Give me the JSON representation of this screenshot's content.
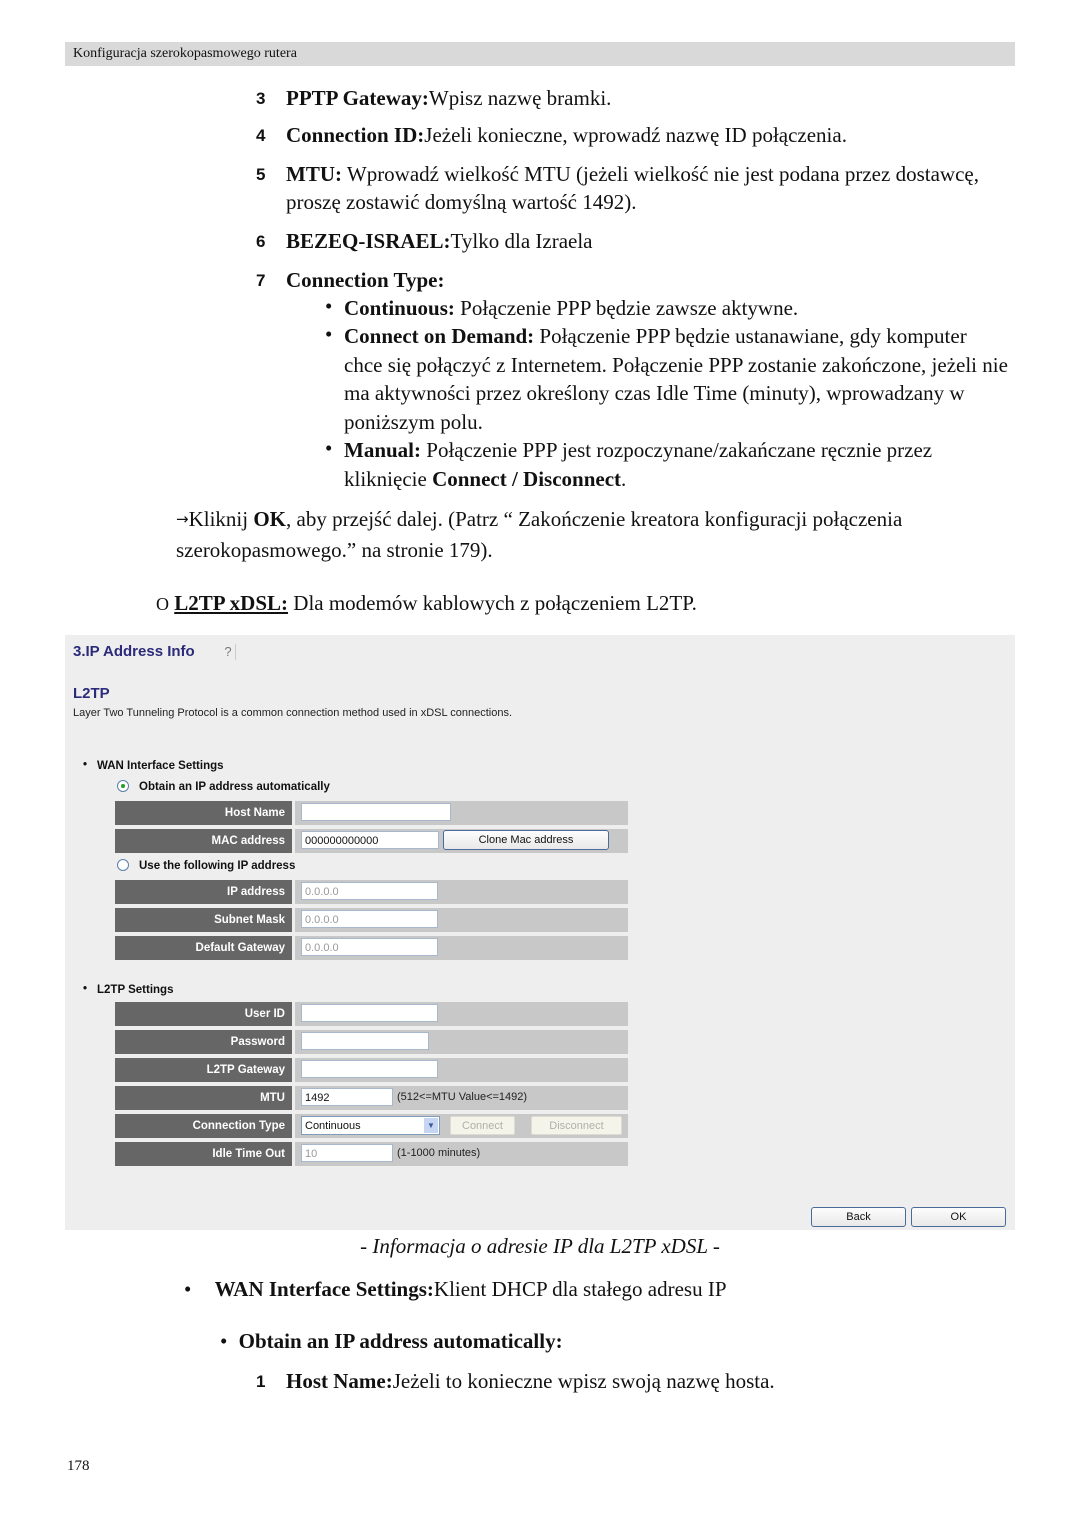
{
  "header": {
    "title": "Konfiguracja szerokopasmowego rutera"
  },
  "steps_top": [
    {
      "num": "3",
      "bold": "PPTP Gateway:",
      "text": "Wpisz nazwę bramki."
    },
    {
      "num": "4",
      "bold": "Connection ID:",
      "text": "Jeżeli konieczne, wprowadź nazwę ID połączenia."
    },
    {
      "num": "5",
      "bold": "MTU:",
      "text": " Wprowadź wielkość MTU (jeżeli wielkość nie jest podana przez dostawcę, proszę zostawić domyślną wartość 1492)."
    },
    {
      "num": "6",
      "bold": "BEZEQ-ISRAEL:",
      "text": "Tylko dla Izraela"
    },
    {
      "num": "7",
      "bold": "Connection Type:",
      "text": ""
    }
  ],
  "connection_types": [
    {
      "bold": "Continuous:",
      "text": " Połączenie PPP będzie zawsze aktywne."
    },
    {
      "bold": "Connect on Demand:",
      "text": " Połączenie PPP będzie ustanawiane, gdy komputer chce się połączyć z Internetem. Połączenie PPP zostanie zakończone, jeżeli nie ma aktywności przez określony czas Idle Time (minuty), wprowadzany w poniższym polu."
    },
    {
      "bold": "Manual:",
      "text": " Połączenie PPP jest rozpoczynane/zakańczane ręcznie przez kliknięcie ",
      "bold2": "Connect / Disconnect",
      "tail": "."
    }
  ],
  "click_ok": {
    "arrow": "→",
    "pre": "Kliknij ",
    "bold": "OK",
    "post": ", aby przejść dalej. (Patrz “ Zakończenie kreatora konfiguracji połączenia szerokopasmowego.” na stronie 179)."
  },
  "l2tp_option": {
    "marker": "O",
    "label": "L2TP xDSL:",
    "text": " Dla modemów kablowych z połączeniem L2TP."
  },
  "screenshot": {
    "title": "3.IP Address Info",
    "help_icon": "help-icon",
    "heading": "L2TP",
    "description": "Layer Two Tunneling Protocol is a common connection method used in xDSL connections.",
    "wan_section": "WAN Interface Settings",
    "radio_auto": {
      "label": "Obtain an IP address automatically",
      "selected": true
    },
    "host_name": {
      "label": "Host Name",
      "value": ""
    },
    "mac_address": {
      "label": "MAC address",
      "value": "000000000000",
      "button": "Clone Mac address"
    },
    "radio_manual": {
      "label": "Use the following IP address",
      "selected": false
    },
    "ip_address": {
      "label": "IP address",
      "value": "0.0.0.0"
    },
    "subnet_mask": {
      "label": "Subnet Mask",
      "value": "0.0.0.0"
    },
    "default_gateway": {
      "label": "Default Gateway",
      "value": "0.0.0.0"
    },
    "l2tp_section": "L2TP Settings",
    "user_id": {
      "label": "User ID",
      "value": ""
    },
    "password": {
      "label": "Password",
      "value": ""
    },
    "l2tp_gateway": {
      "label": "L2TP Gateway",
      "value": ""
    },
    "mtu": {
      "label": "MTU",
      "value": "1492",
      "hint": "(512<=MTU Value<=1492)"
    },
    "connection_type": {
      "label": "Connection Type",
      "value": "Continuous",
      "connect": "Connect",
      "disconnect": "Disconnect"
    },
    "idle_time": {
      "label": "Idle Time Out",
      "value": "10",
      "hint": "(1-1000 minutes)"
    },
    "back": "Back",
    "ok": "OK"
  },
  "caption": "- Informacja o adresie IP dla L2TP xDSL -",
  "wan_note": {
    "bullet": "•",
    "bold": "WAN Interface Settings:",
    "text": "Klient DHCP dla stałego adresu IP"
  },
  "obtain_note": {
    "bullet": "•",
    "bold": "Obtain an IP address automatically:"
  },
  "host_step": {
    "num": "1",
    "bold": "Host Name:",
    "text": "Jeżeli to konieczne wpisz swoją nazwę hosta."
  },
  "page_number": "178"
}
